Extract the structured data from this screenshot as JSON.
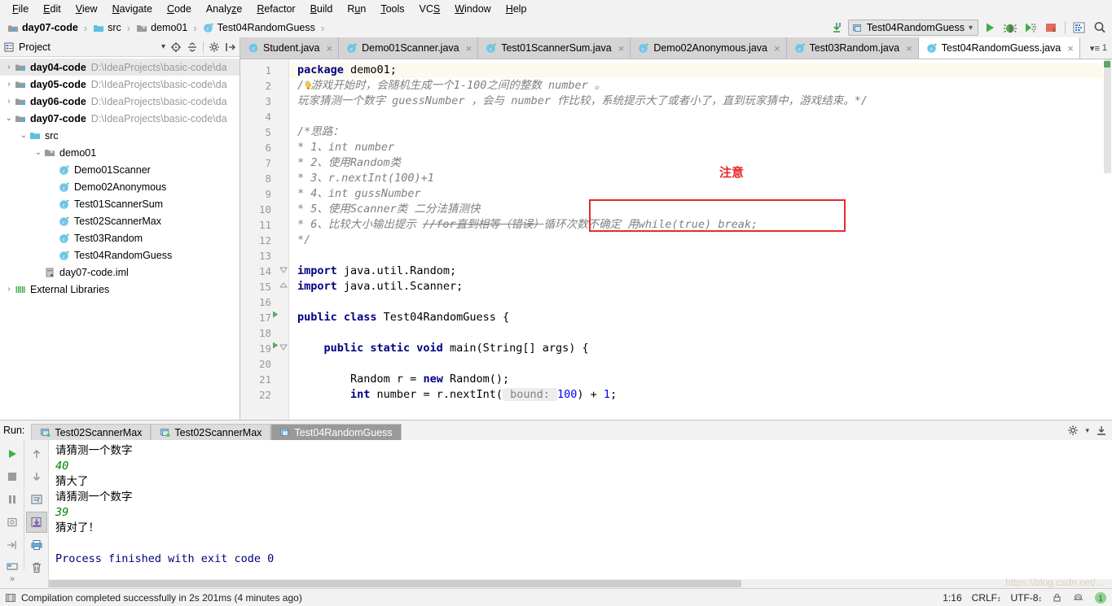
{
  "menubar": {
    "items": [
      {
        "label": "File",
        "accel": "F"
      },
      {
        "label": "Edit",
        "accel": "E"
      },
      {
        "label": "View",
        "accel": "V"
      },
      {
        "label": "Navigate",
        "accel": "N"
      },
      {
        "label": "Code",
        "accel": "C"
      },
      {
        "label": "Analyze",
        "accel": "z"
      },
      {
        "label": "Refactor",
        "accel": "R"
      },
      {
        "label": "Build",
        "accel": "B"
      },
      {
        "label": "Run",
        "accel": "u"
      },
      {
        "label": "Tools",
        "accel": "T"
      },
      {
        "label": "VCS",
        "accel": "S"
      },
      {
        "label": "Window",
        "accel": "W"
      },
      {
        "label": "Help",
        "accel": "H"
      }
    ]
  },
  "breadcrumb": {
    "items": [
      "day07-code",
      "src",
      "demo01",
      "Test04RandomGuess"
    ]
  },
  "toolbar": {
    "run_config": "Test04RandomGuess",
    "buttons": [
      "run-button",
      "debug-button",
      "run-with-coverage-button",
      "stop-button",
      "build-project-button",
      "search-everywhere-button"
    ]
  },
  "project_panel": {
    "title": "Project",
    "tree": [
      {
        "depth": 0,
        "arrow": "›",
        "icon": "module",
        "label": "day04-code",
        "path": "D:\\IdeaProjects\\basic-code\\da",
        "bold": true,
        "selected": true
      },
      {
        "depth": 0,
        "arrow": "›",
        "icon": "module",
        "label": "day05-code",
        "path": "D:\\IdeaProjects\\basic-code\\da",
        "bold": true,
        "selected": false
      },
      {
        "depth": 0,
        "arrow": "›",
        "icon": "module",
        "label": "day06-code",
        "path": "D:\\IdeaProjects\\basic-code\\da",
        "bold": true,
        "selected": false
      },
      {
        "depth": 0,
        "arrow": "⌄",
        "icon": "module",
        "label": "day07-code",
        "path": "D:\\IdeaProjects\\basic-code\\da",
        "bold": true,
        "selected": false
      },
      {
        "depth": 1,
        "arrow": "⌄",
        "icon": "source-folder",
        "label": "src",
        "path": "",
        "bold": false,
        "selected": false
      },
      {
        "depth": 2,
        "arrow": "⌄",
        "icon": "package",
        "label": "demo01",
        "path": "",
        "bold": false,
        "selected": false
      },
      {
        "depth": 3,
        "arrow": "",
        "icon": "java-class",
        "label": "Demo01Scanner",
        "path": "",
        "bold": false,
        "selected": false
      },
      {
        "depth": 3,
        "arrow": "",
        "icon": "java-class",
        "label": "Demo02Anonymous",
        "path": "",
        "bold": false,
        "selected": false
      },
      {
        "depth": 3,
        "arrow": "",
        "icon": "java-class",
        "label": "Test01ScannerSum",
        "path": "",
        "bold": false,
        "selected": false
      },
      {
        "depth": 3,
        "arrow": "",
        "icon": "java-class",
        "label": "Test02ScannerMax",
        "path": "",
        "bold": false,
        "selected": false
      },
      {
        "depth": 3,
        "arrow": "",
        "icon": "java-class",
        "label": "Test03Random",
        "path": "",
        "bold": false,
        "selected": false
      },
      {
        "depth": 3,
        "arrow": "",
        "icon": "java-class",
        "label": "Test04RandomGuess",
        "path": "",
        "bold": false,
        "selected": false
      },
      {
        "depth": 2,
        "arrow": "",
        "icon": "iml-file",
        "label": "day07-code.iml",
        "path": "",
        "bold": false,
        "selected": false
      },
      {
        "depth": 0,
        "arrow": "›",
        "icon": "libraries",
        "label": "External Libraries",
        "path": "",
        "bold": false,
        "selected": false
      }
    ]
  },
  "editor": {
    "tabs": [
      {
        "label": "Student.java",
        "active": false,
        "modified": false
      },
      {
        "label": "Demo01Scanner.java",
        "active": false,
        "modified": true
      },
      {
        "label": "Test01ScannerSum.java",
        "active": false,
        "modified": true
      },
      {
        "label": "Demo02Anonymous.java",
        "active": false,
        "modified": true
      },
      {
        "label": "Test03Random.java",
        "active": false,
        "modified": true
      },
      {
        "label": "Test04RandomGuess.java",
        "active": true,
        "modified": true
      }
    ],
    "tabs_overflow": "1",
    "first_line": 1,
    "lines": [
      {
        "n": 1,
        "current": true,
        "run": false,
        "fold": "",
        "html": "<span class=\"kw\">package</span> demo01;"
      },
      {
        "n": 2,
        "current": false,
        "run": false,
        "fold": "",
        "html": "<span class=\"cmt\">/*游戏开始时，会随机生成一个1-100之间的整数 number 。</span>"
      },
      {
        "n": 3,
        "current": false,
        "run": false,
        "fold": "",
        "html": "<span class=\"cmt\">玩家猜测一个数字 guessNumber ，会与 number 作比较，系统提示大了或者小了，直到玩家猜中，游戏结束。*/</span>"
      },
      {
        "n": 4,
        "current": false,
        "run": false,
        "fold": "",
        "html": ""
      },
      {
        "n": 5,
        "current": false,
        "run": false,
        "fold": "",
        "html": "<span class=\"cmt\">/*思路：</span>"
      },
      {
        "n": 6,
        "current": false,
        "run": false,
        "fold": "",
        "html": "<span class=\"cmt\">* 1、int number</span>"
      },
      {
        "n": 7,
        "current": false,
        "run": false,
        "fold": "",
        "html": "<span class=\"cmt\">* 2、使用Random类</span>"
      },
      {
        "n": 8,
        "current": false,
        "run": false,
        "fold": "",
        "html": "<span class=\"cmt\">* 3、r.nextInt(100)+1</span>"
      },
      {
        "n": 9,
        "current": false,
        "run": false,
        "fold": "",
        "html": "<span class=\"cmt\">* 4、int gussNumber</span>"
      },
      {
        "n": 10,
        "current": false,
        "run": false,
        "fold": "",
        "html": "<span class=\"cmt\">* 5、使用Scanner类 二分法猜测快</span>"
      },
      {
        "n": 11,
        "current": false,
        "run": false,
        "fold": "",
        "html": "<span class=\"cmt\">* 6、比较大小输出提示 <span class=\"strike\">//for直到相等（错误）</span>循环次数不确定 用while(true) break;</span>"
      },
      {
        "n": 12,
        "current": false,
        "run": false,
        "fold": "",
        "html": "<span class=\"cmt\">*/</span>"
      },
      {
        "n": 13,
        "current": false,
        "run": false,
        "fold": "",
        "html": ""
      },
      {
        "n": 14,
        "current": false,
        "run": false,
        "fold": "open",
        "html": "<span class=\"kw\">import</span> java.util.Random;"
      },
      {
        "n": 15,
        "current": false,
        "run": false,
        "fold": "close",
        "html": "<span class=\"kw\">import</span> java.util.Scanner;"
      },
      {
        "n": 16,
        "current": false,
        "run": false,
        "fold": "",
        "html": ""
      },
      {
        "n": 17,
        "current": false,
        "run": true,
        "fold": "",
        "html": "<span class=\"kw\">public class</span> Test04RandomGuess {"
      },
      {
        "n": 18,
        "current": false,
        "run": false,
        "fold": "",
        "html": ""
      },
      {
        "n": 19,
        "current": false,
        "run": true,
        "fold": "open",
        "html": "    <span class=\"kw\">public static void</span> main(String[] args) {"
      },
      {
        "n": 20,
        "current": false,
        "run": false,
        "fold": "",
        "html": ""
      },
      {
        "n": 21,
        "current": false,
        "run": false,
        "fold": "",
        "html": "        Random r = <span class=\"kw\">new</span> Random();"
      },
      {
        "n": 22,
        "current": false,
        "run": false,
        "fold": "",
        "html": "        <span class=\"kw\">int</span> number = r.nextInt(<span class=\"hint\"> bound: </span><span class=\"num\">100</span>) + <span class=\"num\">1</span>;"
      }
    ],
    "annotation": {
      "label": "注意",
      "boxed_text": "循环次数不确定 用while(true) break;",
      "color": "#e52b2b"
    }
  },
  "run_panel": {
    "label": "Run:",
    "tabs": [
      {
        "label": "Test02ScannerMax",
        "active": false
      },
      {
        "label": "Test02ScannerMax",
        "active": false
      },
      {
        "label": "Test04RandomGuess",
        "active": true
      }
    ],
    "left_tools": [
      "rerun-button",
      "stop-button",
      "pause-button",
      "dump-threads-button",
      "restore-layout-button",
      "show-layout-button"
    ],
    "side_tools": [
      "scroll-up-button",
      "scroll-down-button",
      "soft-wrap-button",
      "scroll-to-end-button",
      "print-button",
      "clear-all-button"
    ],
    "console": [
      {
        "text": "请猜测一个数字",
        "kind": "out"
      },
      {
        "text": "40",
        "kind": "in"
      },
      {
        "text": "猜大了",
        "kind": "out"
      },
      {
        "text": "请猜测一个数字",
        "kind": "out"
      },
      {
        "text": "39",
        "kind": "in"
      },
      {
        "text": "猜对了！",
        "kind": "out"
      },
      {
        "text": "",
        "kind": "out"
      },
      {
        "text": "Process finished with exit code 0",
        "kind": "fin"
      }
    ]
  },
  "statusbar": {
    "message": "Compilation completed successfully in 2s 201ms (4 minutes ago)",
    "caret": "1:16",
    "line_sep": "CRLF",
    "encoding": "UTF-8"
  },
  "watermark": "https://blog.csdn.net/..."
}
